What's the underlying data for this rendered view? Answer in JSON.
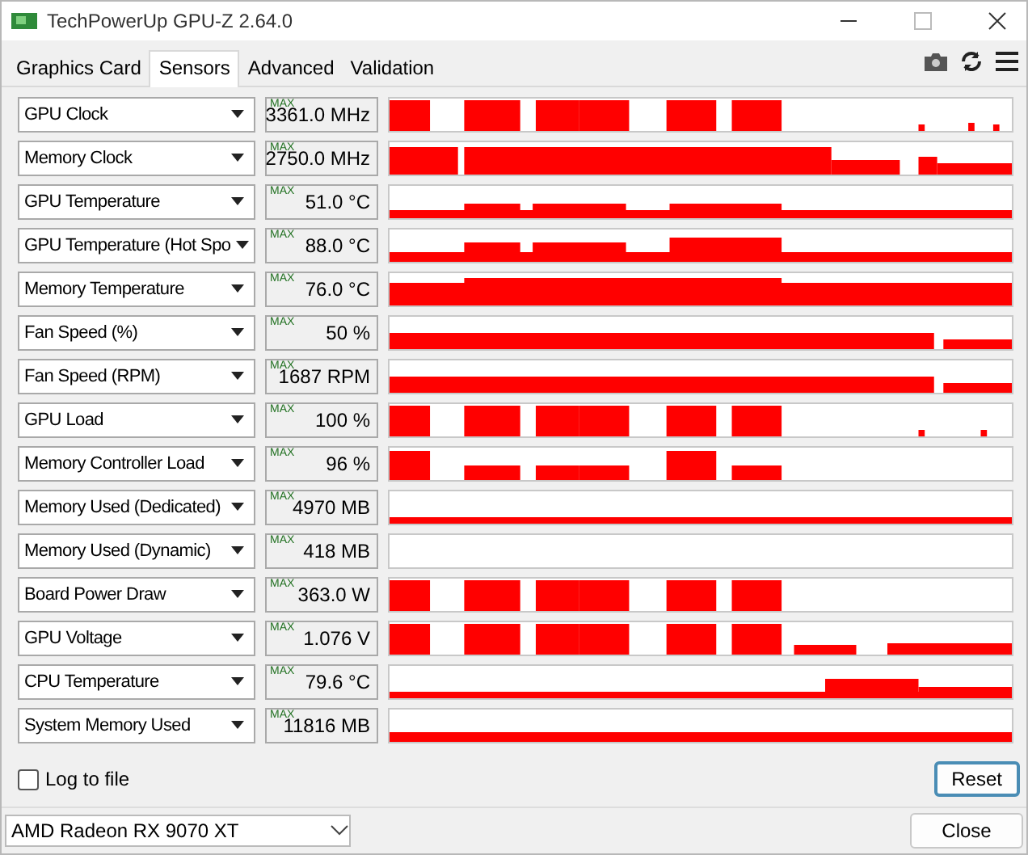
{
  "window": {
    "title": "TechPowerUp GPU-Z 2.64.0"
  },
  "tabs": [
    {
      "label": "Graphics Card",
      "selected": false
    },
    {
      "label": "Sensors",
      "selected": true
    },
    {
      "label": "Advanced",
      "selected": false
    },
    {
      "label": "Validation",
      "selected": false
    }
  ],
  "sensors": [
    {
      "name": "GPU Clock",
      "mode": "MAX",
      "value": "3361.0 MHz"
    },
    {
      "name": "Memory Clock",
      "mode": "MAX",
      "value": "2750.0 MHz"
    },
    {
      "name": "GPU Temperature",
      "mode": "MAX",
      "value": "51.0 °C"
    },
    {
      "name": "GPU Temperature (Hot Spo",
      "mode": "MAX",
      "value": "88.0 °C"
    },
    {
      "name": "Memory Temperature",
      "mode": "MAX",
      "value": "76.0 °C"
    },
    {
      "name": "Fan Speed (%)",
      "mode": "MAX",
      "value": "50 %"
    },
    {
      "name": "Fan Speed (RPM)",
      "mode": "MAX",
      "value": "1687 RPM"
    },
    {
      "name": "GPU Load",
      "mode": "MAX",
      "value": "100 %"
    },
    {
      "name": "Memory Controller Load",
      "mode": "MAX",
      "value": "96 %"
    },
    {
      "name": "Memory Used (Dedicated)",
      "mode": "MAX",
      "value": "4970 MB"
    },
    {
      "name": "Memory Used (Dynamic)",
      "mode": "MAX",
      "value": "418 MB"
    },
    {
      "name": "Board Power Draw",
      "mode": "MAX",
      "value": "363.0 W"
    },
    {
      "name": "GPU Voltage",
      "mode": "MAX",
      "value": "1.076 V"
    },
    {
      "name": "CPU Temperature",
      "mode": "MAX",
      "value": "79.6 °C"
    },
    {
      "name": "System Memory Used",
      "mode": "MAX",
      "value": "11816 MB"
    }
  ],
  "log_to_file": {
    "label": "Log to file",
    "checked": false
  },
  "reset_button": "Reset",
  "gpu_select": {
    "value": "AMD Radeon RX 9070 XT"
  },
  "close_button": "Close"
}
